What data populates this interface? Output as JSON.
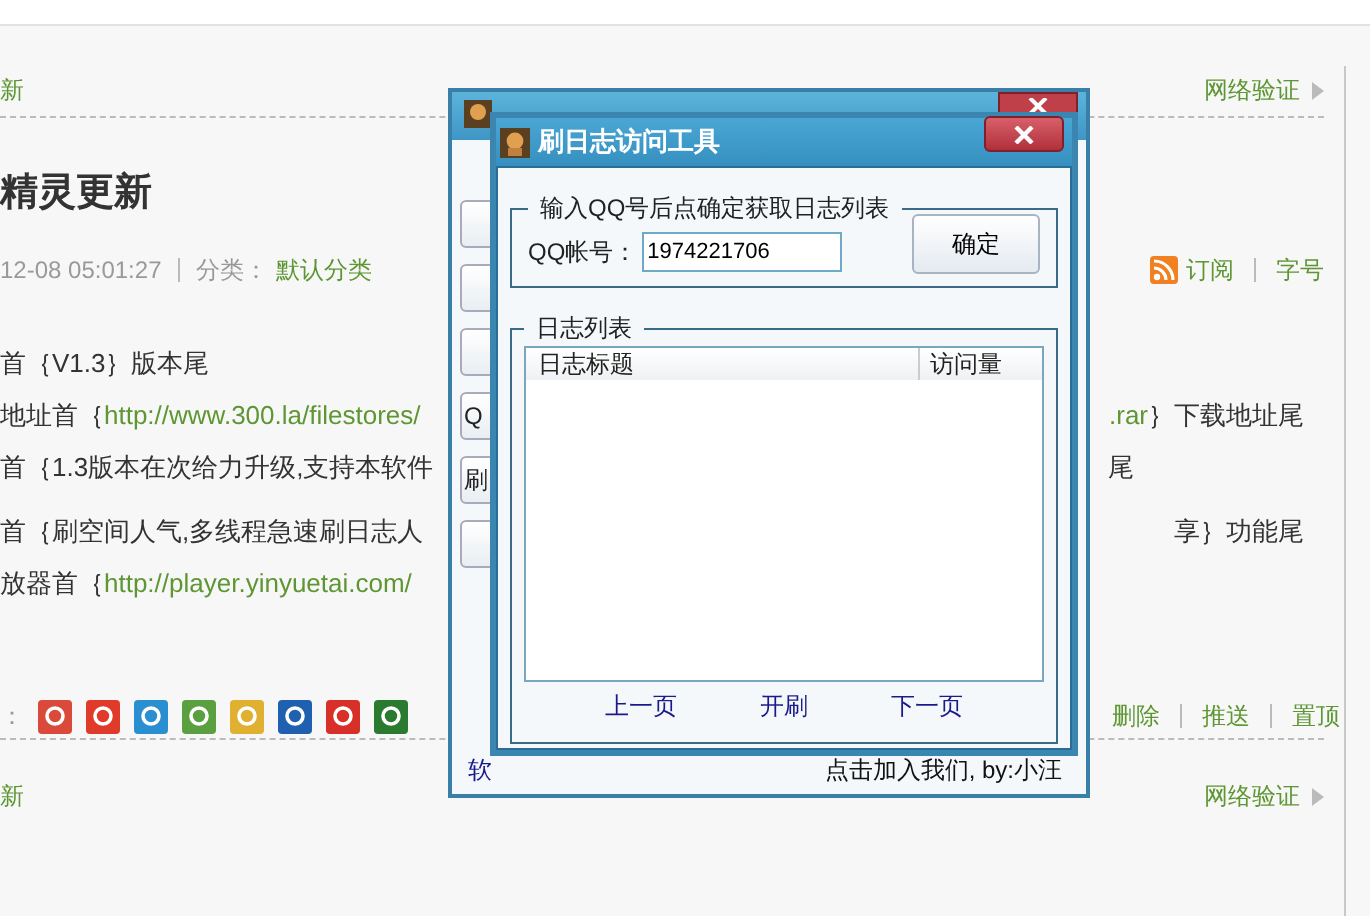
{
  "page": {
    "top_link": "新",
    "top_right_link": "网络验证",
    "post_title": "精灵更新",
    "meta_time": "12-08 05:01:27",
    "meta_category_label": "分类：",
    "meta_category": "默认分类",
    "subscribe": "订阅",
    "font_size": "字号",
    "lines": [
      {
        "segments": [
          {
            "kind": "text",
            "text": "首｛V1.3｝版本尾"
          }
        ]
      },
      {
        "segments": [
          {
            "kind": "text",
            "text": "地址首｛"
          },
          {
            "kind": "link",
            "text": "http://www.300.la/filestores/"
          }
        ],
        "tail": [
          {
            "kind": "link",
            "text": ".rar"
          },
          {
            "kind": "text",
            "text": "｝下载地址尾"
          }
        ]
      },
      {
        "segments": [
          {
            "kind": "text",
            "text": "首｛1.3版本在次给力升级,支持本软件"
          }
        ],
        "tail": [
          {
            "kind": "text",
            "text": "尾"
          }
        ]
      },
      {
        "segments": [
          {
            "kind": "text",
            "text": "首｛刷空间人气,多线程急速刷日志人"
          }
        ],
        "tail": [
          {
            "kind": "text",
            "text": "享｝功能尾"
          }
        ]
      },
      {
        "segments": [
          {
            "kind": "text",
            "text": "放器首｛"
          },
          {
            "kind": "link",
            "text": "http://player.yinyuetai.com/"
          }
        ]
      }
    ],
    "share_label": "：",
    "share_icons": [
      {
        "color": "#d94a3a"
      },
      {
        "color": "#e03a2a"
      },
      {
        "color": "#2a8fd0"
      },
      {
        "color": "#5aa040"
      },
      {
        "color": "#e0b030"
      },
      {
        "color": "#2060b0"
      },
      {
        "color": "#d83028"
      },
      {
        "color": "#2a7a30"
      }
    ],
    "actions": [
      "删除",
      "推送",
      "置顶"
    ],
    "bottom_link": "新",
    "bottom_right_link": "网络验证"
  },
  "back_window": {
    "buttons": [
      {
        "kind": "blank"
      },
      {
        "kind": "blank"
      },
      {
        "kind": "blank"
      },
      {
        "kind": "label",
        "label": "Q"
      },
      {
        "kind": "label",
        "label": "刷"
      },
      {
        "kind": "blank"
      }
    ],
    "footer_left": "软",
    "footer_right": "点击加入我们, by:小汪"
  },
  "dialog": {
    "title": "刷日志访问工具",
    "query_group": "输入QQ号后点确定获取日志列表",
    "qq_label": "QQ帐号：",
    "qq_value": "1974221706",
    "confirm": "确定",
    "list_group": "日志列表",
    "columns": [
      "日志标题",
      "访问量"
    ],
    "pager": [
      "上一页",
      "开刷",
      "下一页"
    ]
  }
}
